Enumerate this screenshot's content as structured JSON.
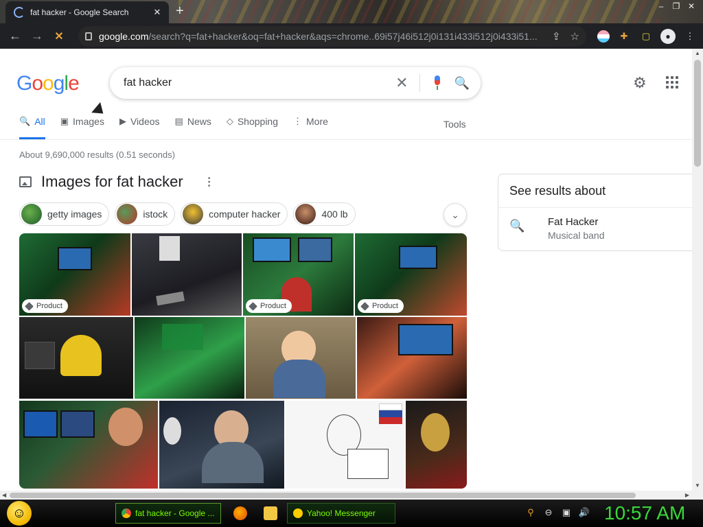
{
  "browser": {
    "tab_title": "fat hacker - Google Search",
    "tab_close": "✕",
    "new_tab": "+",
    "window_controls": [
      "–",
      "❐",
      "✕"
    ],
    "url_host": "google.com",
    "url_path": "/search?q=fat+hacker&oq=fat+hacker&aqs=chrome..69i57j46i512j0i131i433i512j0i433i51..."
  },
  "google": {
    "logo": [
      "G",
      "o",
      "o",
      "g",
      "l",
      "e"
    ],
    "query": "fat hacker",
    "tabs": [
      {
        "icon": "search-icon",
        "glyph": "🔍",
        "label": "All"
      },
      {
        "icon": "image-icon",
        "glyph": "▣",
        "label": "Images"
      },
      {
        "icon": "video-icon",
        "glyph": "▶",
        "label": "Videos"
      },
      {
        "icon": "news-icon",
        "glyph": "▤",
        "label": "News"
      },
      {
        "icon": "tag-icon",
        "glyph": "◇",
        "label": "Shopping"
      },
      {
        "icon": "more-icon",
        "glyph": "⋮",
        "label": "More"
      }
    ],
    "tools_label": "Tools",
    "result_stats": "About 9,690,000 results (0.51 seconds)",
    "images_heading": "Images for fat hacker",
    "chips": [
      {
        "label": "getty images",
        "color": "#2d6e3a"
      },
      {
        "label": "istock",
        "color": "#3b6b44"
      },
      {
        "label": "computer hacker",
        "color": "#c9a227"
      },
      {
        "label": "400 lb",
        "color": "#7a3a2a"
      }
    ],
    "images": [
      {
        "badge": "Product",
        "colors": [
          "#1e6b34",
          "#b83a25"
        ]
      },
      {
        "badge": "",
        "colors": [
          "#2a2a30",
          "#8c8c8c"
        ]
      },
      {
        "badge": "Product",
        "colors": [
          "#174d22",
          "#3a9a4a"
        ]
      },
      {
        "badge": "Product",
        "colors": [
          "#1e6b34",
          "#c04a2e"
        ]
      },
      {
        "badge": "",
        "colors": [
          "#1b1b1b",
          "#e8c21e"
        ]
      },
      {
        "badge": "",
        "colors": [
          "#0f3a1a",
          "#2fa04a"
        ]
      },
      {
        "badge": "",
        "colors": [
          "#8a7a5a",
          "#4a6a9a"
        ]
      },
      {
        "badge": "",
        "colors": [
          "#3a1a14",
          "#d0603a"
        ]
      },
      {
        "badge": "",
        "colors": [
          "#14381e",
          "#c0302a"
        ]
      },
      {
        "badge": "",
        "colors": [
          "#1a2230",
          "#6a7a8a"
        ]
      },
      {
        "badge": "",
        "colors": [
          "#f4f4f4",
          "#cc2a2a"
        ]
      },
      {
        "badge": "",
        "colors": [
          "#1a1a1a",
          "#c8a040"
        ]
      }
    ],
    "knowledge_panel": {
      "heading": "See results about",
      "title": "Fat Hacker",
      "subtitle": "Musical band"
    }
  },
  "taskbar": {
    "buttons": [
      {
        "label": "fat hacker - Google ...",
        "icon_color": "#4285f4"
      },
      {
        "label": "Yahoo! Messenger",
        "icon_color": "#ffcc00"
      }
    ],
    "clock": "10:57 AM"
  }
}
